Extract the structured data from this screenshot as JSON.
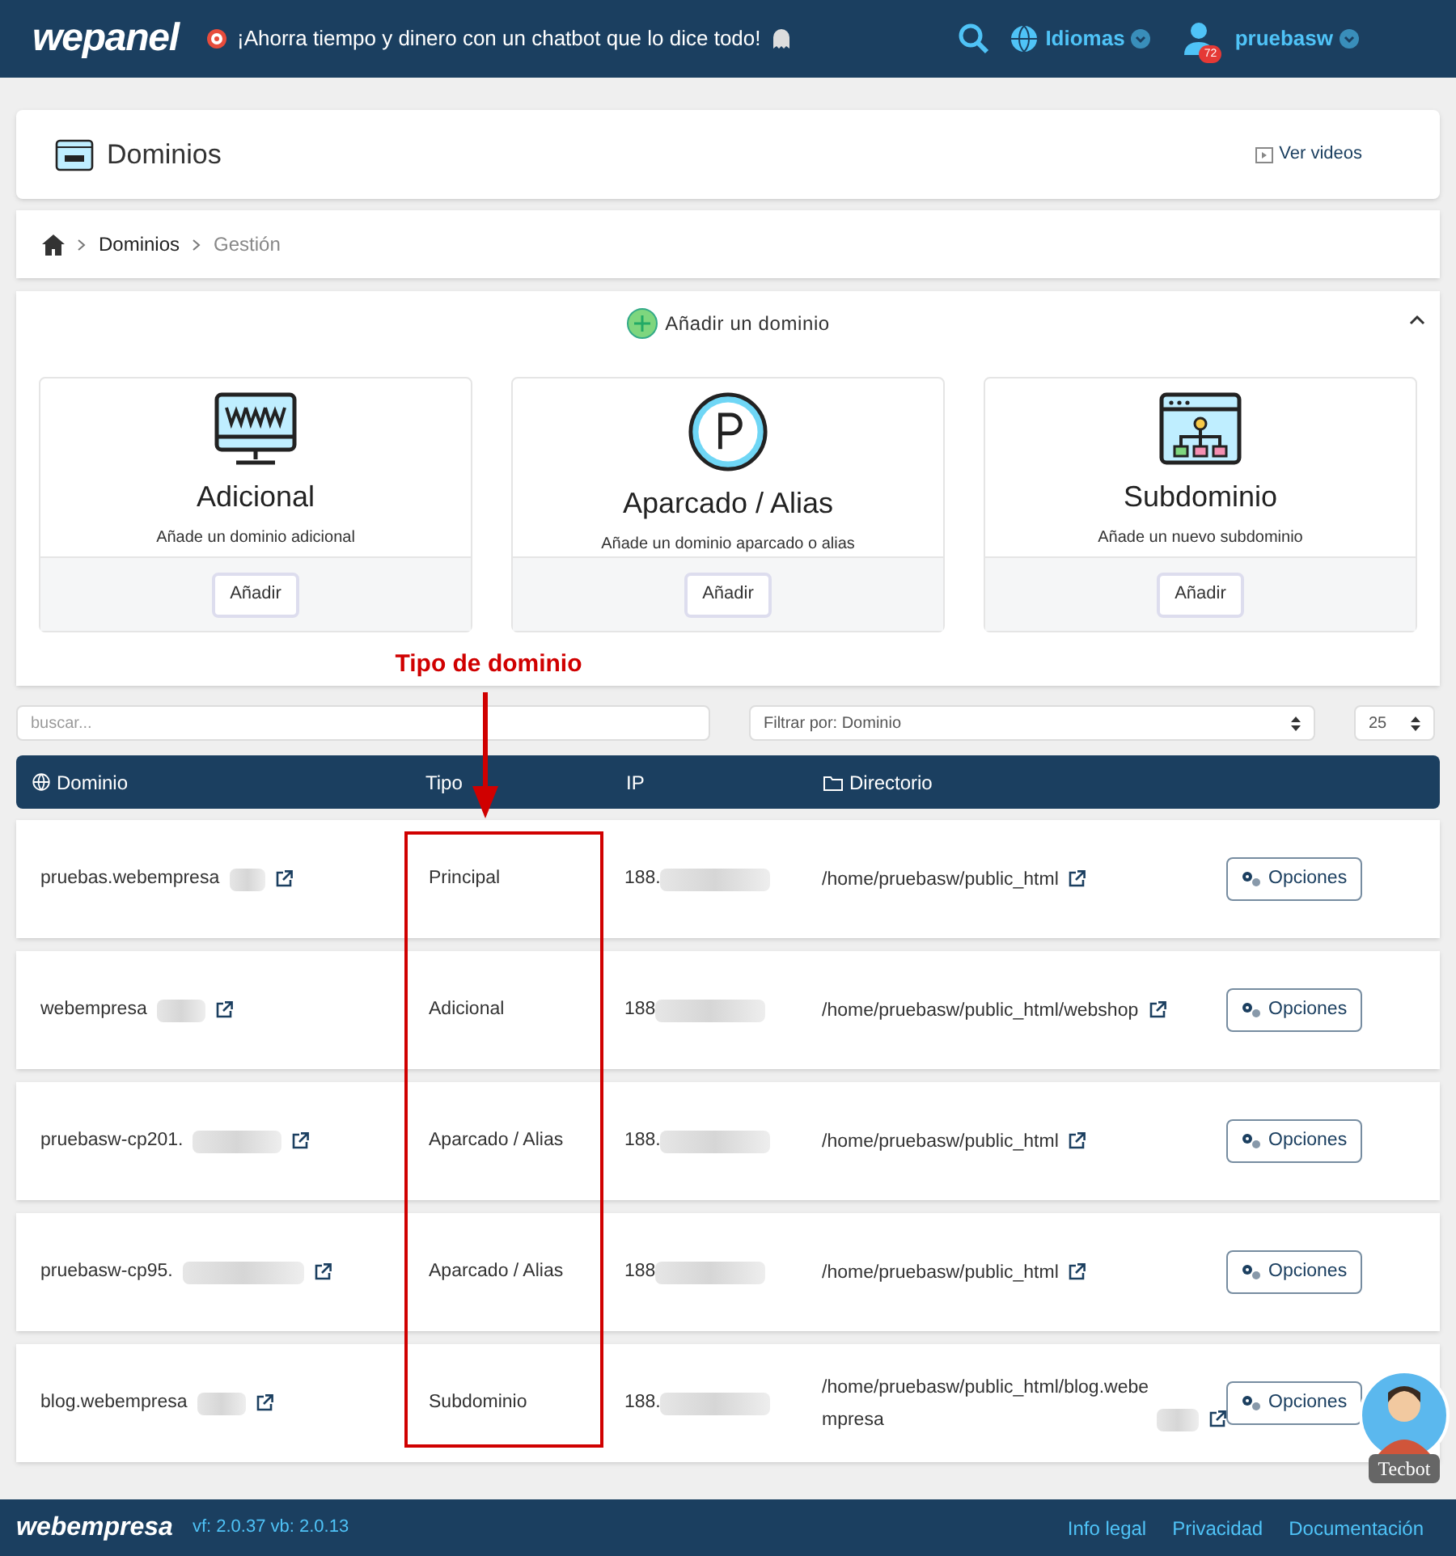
{
  "header": {
    "logo": "wepanel",
    "promo": "¡Ahorra tiempo y dinero con un chatbot que lo dice todo!",
    "languages": "Idiomas",
    "user": "pruebasw",
    "notifications": "72"
  },
  "page": {
    "title": "Dominios",
    "videos_link": "Ver videos"
  },
  "breadcrumb": [
    {
      "label": "Dominios",
      "current": false
    },
    {
      "label": "Gestión",
      "current": true
    }
  ],
  "add_panel": {
    "title": "Añadir un dominio",
    "expanded": true,
    "options": [
      {
        "kind": "www",
        "title": "Adicional",
        "description": "Añade un dominio adicional",
        "button": "Añadir"
      },
      {
        "kind": "parked",
        "title": "Aparcado / Alias",
        "description": "Añade un dominio aparcado o alias",
        "button": "Añadir"
      },
      {
        "kind": "subdomain",
        "title": "Subdominio",
        "description": "Añade un nuevo subdominio",
        "button": "Añadir"
      }
    ]
  },
  "filters": {
    "search_placeholder": "buscar...",
    "filter": "Filtrar por: Dominio",
    "per_page": "25"
  },
  "table": {
    "columns": [
      "Dominio",
      "Tipo",
      "IP",
      "Directorio"
    ],
    "rows": [
      {
        "domain": "pruebas.webempresa",
        "type": "Principal",
        "ip": "188.",
        "directory": "/home/pruebasw/public_html",
        "directory_blurred": false,
        "button": "Opciones"
      },
      {
        "domain": "webempresa",
        "type": "Adicional",
        "ip": "188",
        "directory": "/home/pruebasw/public_html/webshop",
        "directory_blurred": false,
        "button": "Opciones"
      },
      {
        "domain": "pruebasw-cp201.",
        "type": "Aparcado / Alias",
        "ip": "188.",
        "directory": "/home/pruebasw/public_html",
        "directory_blurred": false,
        "button": "Opciones"
      },
      {
        "domain": "pruebasw-cp95.",
        "type": "Aparcado / Alias",
        "ip": "188",
        "directory": "/home/pruebasw/public_html",
        "directory_blurred": false,
        "button": "Opciones"
      },
      {
        "domain": "blog.webempresa",
        "type": "Subdominio",
        "ip": "188.",
        "directory": "/home/pruebasw/public_html/blog.webempresa",
        "directory_blurred": true,
        "button": "Opciones"
      }
    ]
  },
  "annotation": {
    "label": "Tipo de dominio"
  },
  "chat": {
    "label": "Tecbot"
  },
  "footer": {
    "logo": "webempresa",
    "version": "vf: 2.0.37 vb: 2.0.13",
    "links": [
      "Info legal",
      "Privacidad",
      "Documentación"
    ]
  }
}
